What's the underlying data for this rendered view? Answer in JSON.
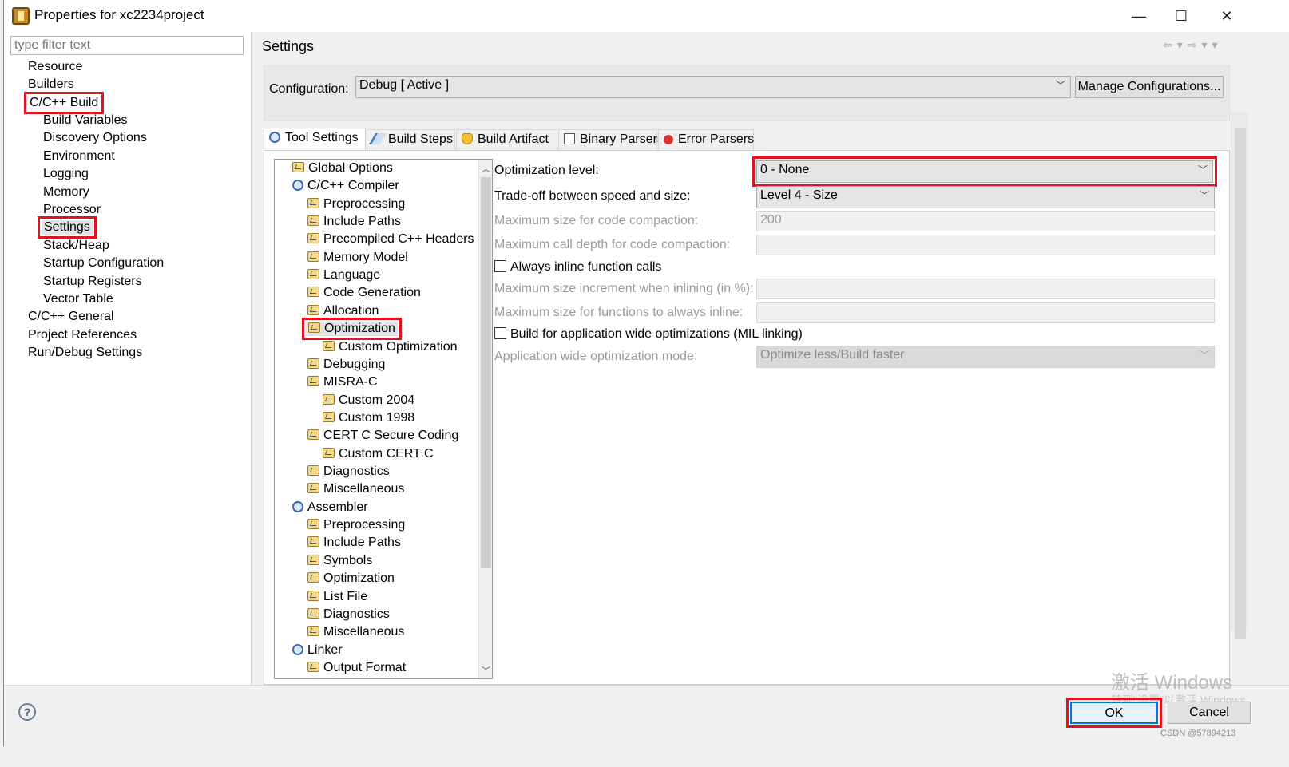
{
  "window": {
    "title": "Properties for xc2234project",
    "minimize": "—",
    "maximize": "☐",
    "close": "✕"
  },
  "left": {
    "filter_placeholder": "type filter text",
    "items": [
      {
        "label": "Resource"
      },
      {
        "label": "Builders"
      },
      {
        "label": "C/C++ Build"
      },
      {
        "label": "Build Variables"
      },
      {
        "label": "Discovery Options"
      },
      {
        "label": "Environment"
      },
      {
        "label": "Logging"
      },
      {
        "label": "Memory"
      },
      {
        "label": "Processor"
      },
      {
        "label": "Settings"
      },
      {
        "label": "Stack/Heap"
      },
      {
        "label": "Startup Configuration"
      },
      {
        "label": "Startup Registers"
      },
      {
        "label": "Vector Table"
      },
      {
        "label": "C/C++ General"
      },
      {
        "label": "Project References"
      },
      {
        "label": "Run/Debug Settings"
      }
    ]
  },
  "page": {
    "title": "Settings",
    "nav_icons": "⇦▾⇨▾▾"
  },
  "config": {
    "label": "Configuration:",
    "value": "Debug  [ Active ]",
    "manage_button": "Manage Configurations..."
  },
  "tabs": [
    {
      "label": "Tool Settings",
      "icon": "tool-settings-icon"
    },
    {
      "label": "Build Steps",
      "icon": "build-steps-icon"
    },
    {
      "label": "Build Artifact",
      "icon": "build-artifact-icon"
    },
    {
      "label": "Binary Parsers",
      "icon": "binary-parsers-icon"
    },
    {
      "label": "Error Parsers",
      "icon": "error-parsers-icon"
    }
  ],
  "tree": [
    {
      "label": "Global Options"
    },
    {
      "label": "C/C++ Compiler"
    },
    {
      "label": "Preprocessing"
    },
    {
      "label": "Include Paths"
    },
    {
      "label": "Precompiled C++ Headers"
    },
    {
      "label": "Memory Model"
    },
    {
      "label": "Language"
    },
    {
      "label": "Code Generation"
    },
    {
      "label": "Allocation"
    },
    {
      "label": "Optimization"
    },
    {
      "label": "Custom Optimization"
    },
    {
      "label": "Debugging"
    },
    {
      "label": "MISRA-C"
    },
    {
      "label": "Custom 2004"
    },
    {
      "label": "Custom 1998"
    },
    {
      "label": "CERT C Secure Coding"
    },
    {
      "label": "Custom CERT C"
    },
    {
      "label": "Diagnostics"
    },
    {
      "label": "Miscellaneous"
    },
    {
      "label": "Assembler"
    },
    {
      "label": "Preprocessing"
    },
    {
      "label": "Include Paths"
    },
    {
      "label": "Symbols"
    },
    {
      "label": "Optimization"
    },
    {
      "label": "List File"
    },
    {
      "label": "Diagnostics"
    },
    {
      "label": "Miscellaneous"
    },
    {
      "label": "Linker"
    },
    {
      "label": "Output Format"
    }
  ],
  "options": {
    "opt_level_label": "Optimization level:",
    "opt_level_value": "0 - None",
    "tradeoff_label": "Trade-off between speed and size:",
    "tradeoff_value": "Level 4 - Size",
    "max_code_compaction_label": "Maximum size for code compaction:",
    "max_code_compaction_value": "200",
    "max_call_depth_label": "Maximum call depth for code compaction:",
    "max_call_depth_value": "",
    "always_inline_label": "Always inline function calls",
    "max_inline_increment_label": "Maximum size increment when inlining (in %):",
    "max_inline_increment_value": "",
    "max_inline_functions_label": "Maximum size for functions to always inline:",
    "max_inline_functions_value": "",
    "mil_label": "Build for application wide optimizations (MIL linking)",
    "app_mode_label": "Application wide optimization mode:",
    "app_mode_value": "Optimize less/Build faster"
  },
  "bottom": {
    "help": "?",
    "ok": "OK",
    "cancel": "Cancel",
    "watermark1": "激活 Windows",
    "watermark2": "转到\"设置\"以激活 Windows",
    "csdn": "CSDN @57894213"
  }
}
